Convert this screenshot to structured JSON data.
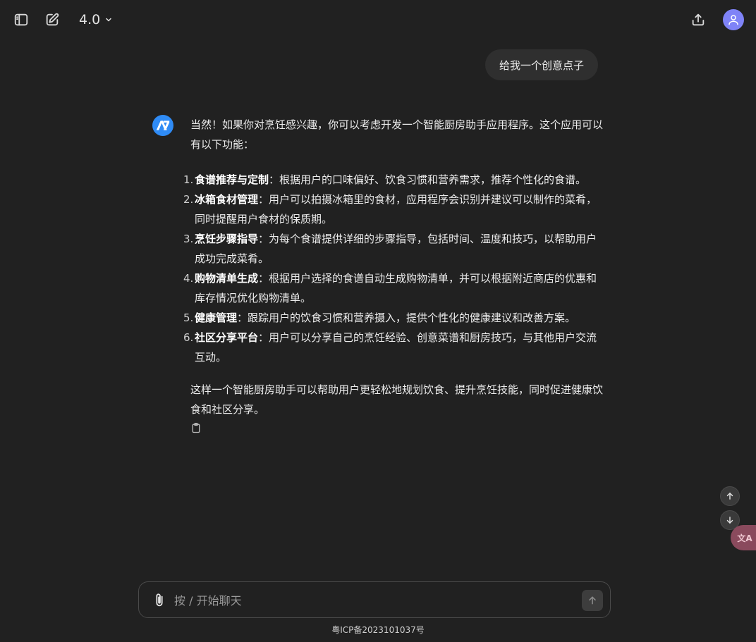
{
  "header": {
    "model_label": "4.0"
  },
  "thread": {
    "user_message": "给我一个创意点子",
    "assistant": {
      "intro": "当然！如果你对烹饪感兴趣，你可以考虑开发一个智能厨房助手应用程序。这个应用可以有以下功能：",
      "items": [
        {
          "num": "1.",
          "title": "食谱推荐与定制",
          "text": "：根据用户的口味偏好、饮食习惯和营养需求，推荐个性化的食谱。"
        },
        {
          "num": "2.",
          "title": "冰箱食材管理",
          "text": "：用户可以拍摄冰箱里的食材，应用程序会识别并建议可以制作的菜肴，同时提醒用户食材的保质期。"
        },
        {
          "num": "3.",
          "title": "烹饪步骤指导",
          "text": "：为每个食谱提供详细的步骤指导，包括时间、温度和技巧，以帮助用户成功完成菜肴。"
        },
        {
          "num": "4.",
          "title": "购物清单生成",
          "text": "：根据用户选择的食谱自动生成购物清单，并可以根据附近商店的优惠和库存情况优化购物清单。"
        },
        {
          "num": "5.",
          "title": "健康管理",
          "text": "：跟踪用户的饮食习惯和营养摄入，提供个性化的健康建议和改善方案。"
        },
        {
          "num": "6.",
          "title": "社区分享平台",
          "text": "：用户可以分享自己的烹饪经验、创意菜谱和厨房技巧，与其他用户交流互动。"
        }
      ],
      "conclusion": "这样一个智能厨房助手可以帮助用户更轻松地规划饮食、提升烹饪技能，同时促进健康饮食和社区分享。"
    }
  },
  "input": {
    "placeholder": "按 / 开始聊天",
    "value": ""
  },
  "translate_label": "文A",
  "footer": {
    "icp": "粤ICP备2023101037号"
  },
  "colors": {
    "background": "#212121",
    "bubble": "#2f2f2f",
    "avatar_user": "#7f83f7",
    "avatar_assistant": "#2f8bf5",
    "translate": "#8a4a5d"
  }
}
